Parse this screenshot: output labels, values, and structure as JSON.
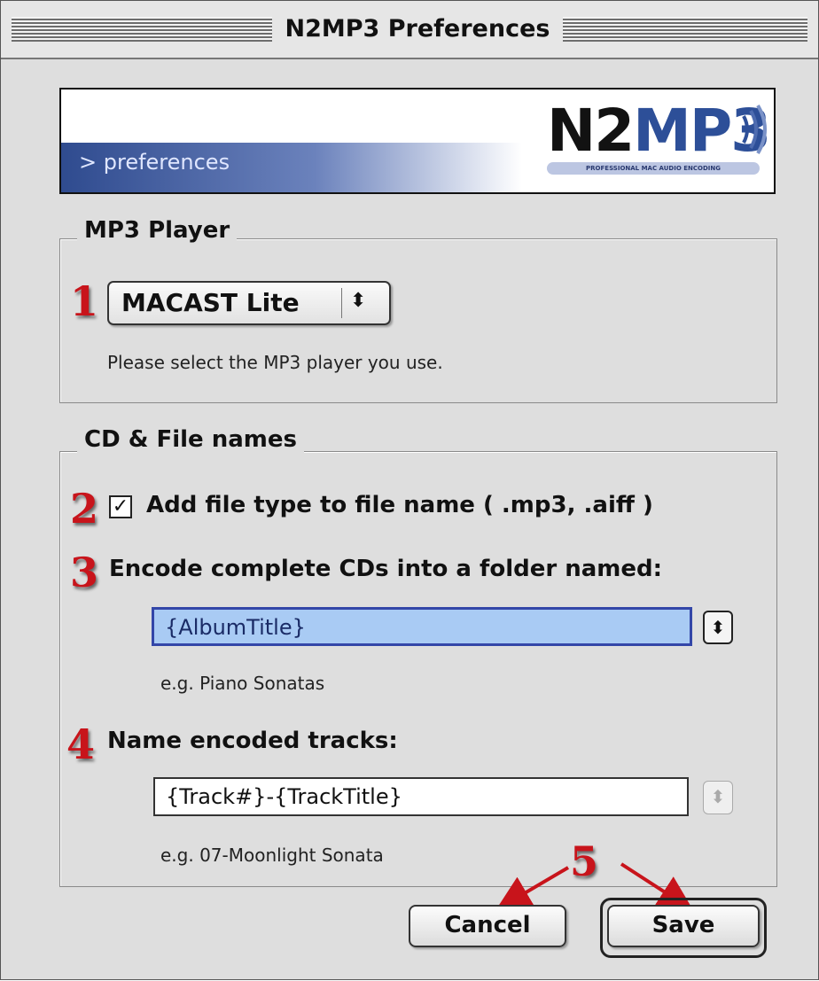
{
  "window": {
    "title": "N2MP3 Preferences"
  },
  "banner": {
    "label": "> preferences",
    "logo_part1": "N2",
    "logo_part2": "MP3",
    "logo_tagline": "PROFESSIONAL MAC AUDIO ENCODING"
  },
  "mp3_player": {
    "group_title": "MP3 Player",
    "selected": "MACAST Lite",
    "hint": "Please select the MP3 player you use."
  },
  "cd_file_names": {
    "group_title": "CD & File names",
    "add_file_type_label": "Add file type to file name ( .mp3, .aiff )",
    "add_file_type_checked": true,
    "folder_label": "Encode complete CDs into a folder named:",
    "folder_value": "{AlbumTitle}",
    "folder_example": "e.g. Piano Sonatas",
    "tracks_label": "Name encoded tracks:",
    "tracks_value": "{Track#}-{TrackTitle}",
    "tracks_example": "e.g. 07-Moonlight Sonata"
  },
  "buttons": {
    "cancel": "Cancel",
    "save": "Save"
  },
  "annotations": {
    "step1": "1",
    "step2": "2",
    "step3": "3",
    "step4": "4",
    "step5": "5"
  },
  "colors": {
    "annotation_red": "#c8141b",
    "selection_blue": "#a9cbf4",
    "banner_blue": "#2f4b8f"
  }
}
